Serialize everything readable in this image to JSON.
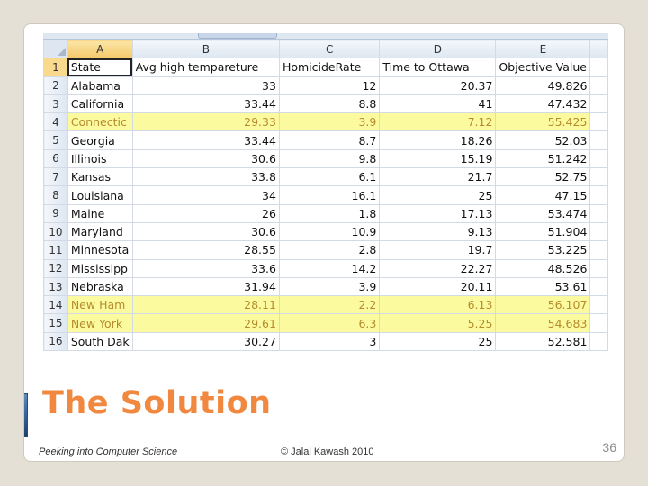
{
  "spreadsheet": {
    "column_headers": [
      "A",
      "B",
      "C",
      "D",
      "E"
    ],
    "header_row": {
      "row_number": "1",
      "cells": [
        "State",
        "Avg high tempareture",
        "HomicideRate",
        "Time to Ottawa",
        "Objective Value"
      ]
    },
    "rows": [
      {
        "n": "2",
        "state": "Alabama",
        "temp": "33",
        "homicide": "12",
        "ottawa": "20.37",
        "objective": "49.826",
        "highlighted": false
      },
      {
        "n": "3",
        "state": "California",
        "temp": "33.44",
        "homicide": "8.8",
        "ottawa": "41",
        "objective": "47.432",
        "highlighted": false
      },
      {
        "n": "4",
        "state": "Connectic",
        "temp": "29.33",
        "homicide": "3.9",
        "ottawa": "7.12",
        "objective": "55.425",
        "highlighted": true
      },
      {
        "n": "5",
        "state": "Georgia",
        "temp": "33.44",
        "homicide": "8.7",
        "ottawa": "18.26",
        "objective": "52.03",
        "highlighted": false
      },
      {
        "n": "6",
        "state": "Illinois",
        "temp": "30.6",
        "homicide": "9.8",
        "ottawa": "15.19",
        "objective": "51.242",
        "highlighted": false
      },
      {
        "n": "7",
        "state": "Kansas",
        "temp": "33.8",
        "homicide": "6.1",
        "ottawa": "21.7",
        "objective": "52.75",
        "highlighted": false
      },
      {
        "n": "8",
        "state": "Louisiana",
        "temp": "34",
        "homicide": "16.1",
        "ottawa": "25",
        "objective": "47.15",
        "highlighted": false
      },
      {
        "n": "9",
        "state": "Maine",
        "temp": "26",
        "homicide": "1.8",
        "ottawa": "17.13",
        "objective": "53.474",
        "highlighted": false
      },
      {
        "n": "10",
        "state": "Maryland",
        "temp": "30.6",
        "homicide": "10.9",
        "ottawa": "9.13",
        "objective": "51.904",
        "highlighted": false
      },
      {
        "n": "11",
        "state": "Minnesota",
        "temp": "28.55",
        "homicide": "2.8",
        "ottawa": "19.7",
        "objective": "53.225",
        "highlighted": false
      },
      {
        "n": "12",
        "state": "Mississipp",
        "temp": "33.6",
        "homicide": "14.2",
        "ottawa": "22.27",
        "objective": "48.526",
        "highlighted": false
      },
      {
        "n": "13",
        "state": "Nebraska",
        "temp": "31.94",
        "homicide": "3.9",
        "ottawa": "20.11",
        "objective": "53.61",
        "highlighted": false
      },
      {
        "n": "14",
        "state": "New Ham",
        "temp": "28.11",
        "homicide": "2.2",
        "ottawa": "6.13",
        "objective": "56.107",
        "highlighted": true
      },
      {
        "n": "15",
        "state": "New York",
        "temp": "29.61",
        "homicide": "6.3",
        "ottawa": "5.25",
        "objective": "54.683",
        "highlighted": true
      },
      {
        "n": "16",
        "state": "South Dak",
        "temp": "30.27",
        "homicide": "3",
        "ottawa": "25",
        "objective": "52.581",
        "highlighted": false
      }
    ]
  },
  "slide": {
    "title": "The Solution",
    "footer_left": "Peeking into Computer Science",
    "footer_center": "© Jalal Kawash 2010",
    "page_number": "36"
  },
  "colors": {
    "title": "#f0883f",
    "highlight_fill": "#fbfa9e",
    "highlight_text": "#b68b2d"
  }
}
